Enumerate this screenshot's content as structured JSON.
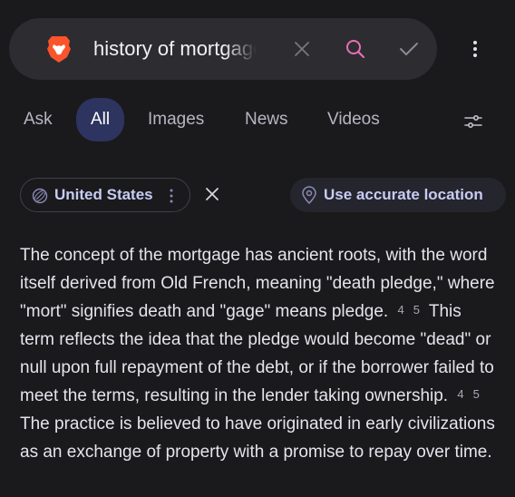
{
  "search": {
    "query": "history of mortgage",
    "icons": [
      "brave-lion-icon",
      "clear-icon",
      "search-icon",
      "check-icon"
    ]
  },
  "menu": {
    "icon": "kebab-menu-icon"
  },
  "tabs": [
    {
      "label": "Ask",
      "active": false
    },
    {
      "label": "All",
      "active": true
    },
    {
      "label": "Images",
      "active": false
    },
    {
      "label": "News",
      "active": false
    },
    {
      "label": "Videos",
      "active": false
    }
  ],
  "filters": {
    "region_label": "United States",
    "location_label": "Use accurate location",
    "icons": [
      "globe-icon",
      "more-vertical-icon",
      "close-icon",
      "location-pin-icon",
      "filter-settings-icon"
    ]
  },
  "answer": {
    "seg1": "The concept of the mortgage has ancient roots, with the word itself derived from Old French, meaning \"death pledge,\" where \"mort\" signifies death and \"gage\" means pledge.",
    "cite1a": "4",
    "cite1b": "5",
    "seg2": "This term reflects the idea that the pledge would become \"dead\" or null upon full repayment of the debt, or if the borrower failed to meet the terms, resulting in the lender taking ownership.",
    "cite2a": "4",
    "cite2b": "5",
    "seg3": "The practice is believed to have originated in early civilizations as an exchange of property with a promise to repay over time."
  },
  "colors": {
    "background": "#1a1a1d",
    "searchbar": "#2c2c31",
    "active_tab": "#2e3460",
    "accent_text": "#c8ccf4",
    "brave_orange": "#fb542b",
    "search_icon_pink": "#e86fb4"
  }
}
